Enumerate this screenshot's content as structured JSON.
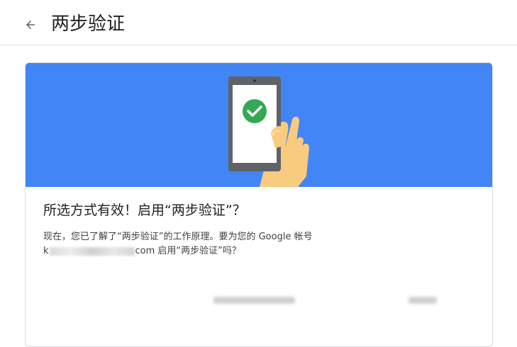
{
  "header": {
    "back_icon": "arrow-back-icon",
    "title": "两步验证"
  },
  "card": {
    "banner_color": "#4285f4",
    "illustration": "phone-checkmark-icon",
    "heading": "所选方式有效！启用“两步验证”？",
    "line1": "现在，您已了解了“两步验证”的工作原理。要为您的 Google 帐号",
    "email_prefix": "k",
    "email_suffix": "com 启用“两步验证”吗？"
  }
}
